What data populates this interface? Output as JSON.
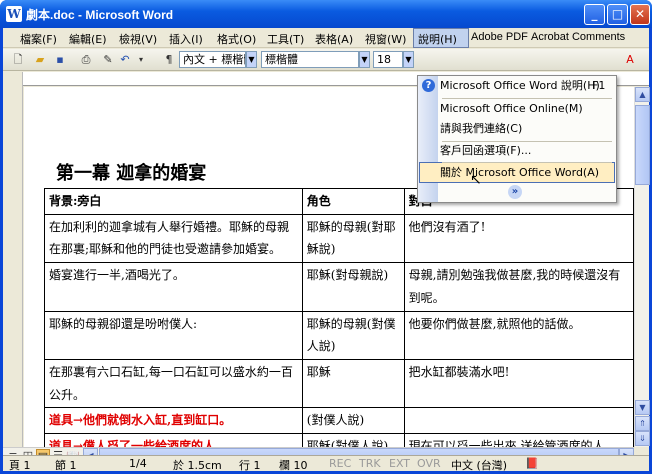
{
  "window": {
    "title": "劇本.doc - Microsoft Word",
    "icon": "W",
    "buttons": {
      "minimize": "_",
      "maximize": "□",
      "close": "✕"
    }
  },
  "menus": [
    {
      "id": "file",
      "label": "檔案(F)"
    },
    {
      "id": "edit",
      "label": "編輯(E)"
    },
    {
      "id": "view",
      "label": "檢視(V)"
    },
    {
      "id": "insert",
      "label": "插入(I)"
    },
    {
      "id": "format",
      "label": "格式(O)"
    },
    {
      "id": "tools",
      "label": "工具(T)"
    },
    {
      "id": "table",
      "label": "表格(A)"
    },
    {
      "id": "window",
      "label": "視窗(W)"
    },
    {
      "id": "help",
      "label": "說明(H)"
    },
    {
      "id": "adobe",
      "label": "Adobe PDF"
    },
    {
      "id": "acrobat",
      "label": "Acrobat Comments"
    }
  ],
  "toolbar": {
    "style": "內文 + 標楷體",
    "font": "標楷體",
    "size": "18"
  },
  "help_menu": {
    "items": [
      {
        "label": "Microsoft Office Word 說明(H)",
        "shortcut": "F1",
        "icon": "help-icon"
      },
      {
        "label": "Microsoft Office Online(M)"
      },
      {
        "label": "請與我們連絡(C)"
      },
      {
        "label": "客戶回函選項(F)..."
      },
      {
        "label": "關於 Microsoft Office Word(A)"
      }
    ],
    "expand": "»"
  },
  "document": {
    "heading": "第一幕 迦拿的婚宴",
    "headers": [
      "背景:旁白",
      "角色",
      "對白"
    ],
    "rows": [
      [
        "在加利利的迦拿城有人舉行婚禮。耶穌的母親在那裏;耶穌和他的門徒也受邀請參加婚宴。",
        "耶穌的母親(對耶穌說)",
        "他們沒有酒了!"
      ],
      [
        "婚宴進行一半,酒喝光了。",
        "耶穌(對母親說)",
        "母親,請別勉強我做甚麼,我的時候還沒有到呢。"
      ],
      [
        "耶穌的母親卻還是吩咐僕人:",
        "耶穌的母親(對僕人說)",
        "他要你們做甚麼,就照他的話做。"
      ],
      [
        "在那裏有六口石缸,每一口石缸可以盛水約一百公升。",
        "耶穌",
        "把水缸都裝滿水吧!"
      ],
      [
        "道具→他們就倒水入缸,直到缸口。",
        "(對僕人說)",
        ""
      ],
      [
        "道具→僕人舀了一些給酒席的人",
        "耶穌(對僕人說)",
        "現在可以舀一些出來,送給管酒席的人。"
      ]
    ]
  },
  "status": {
    "page": "頁 1",
    "section": "節 1",
    "pages": "1/4",
    "at": "於 1.5cm",
    "line": "行 1",
    "col": "欄 10",
    "rec": "REC",
    "trk": "TRK",
    "ext": "EXT",
    "ovr": "OVR",
    "lang": "中文 (台灣)"
  }
}
